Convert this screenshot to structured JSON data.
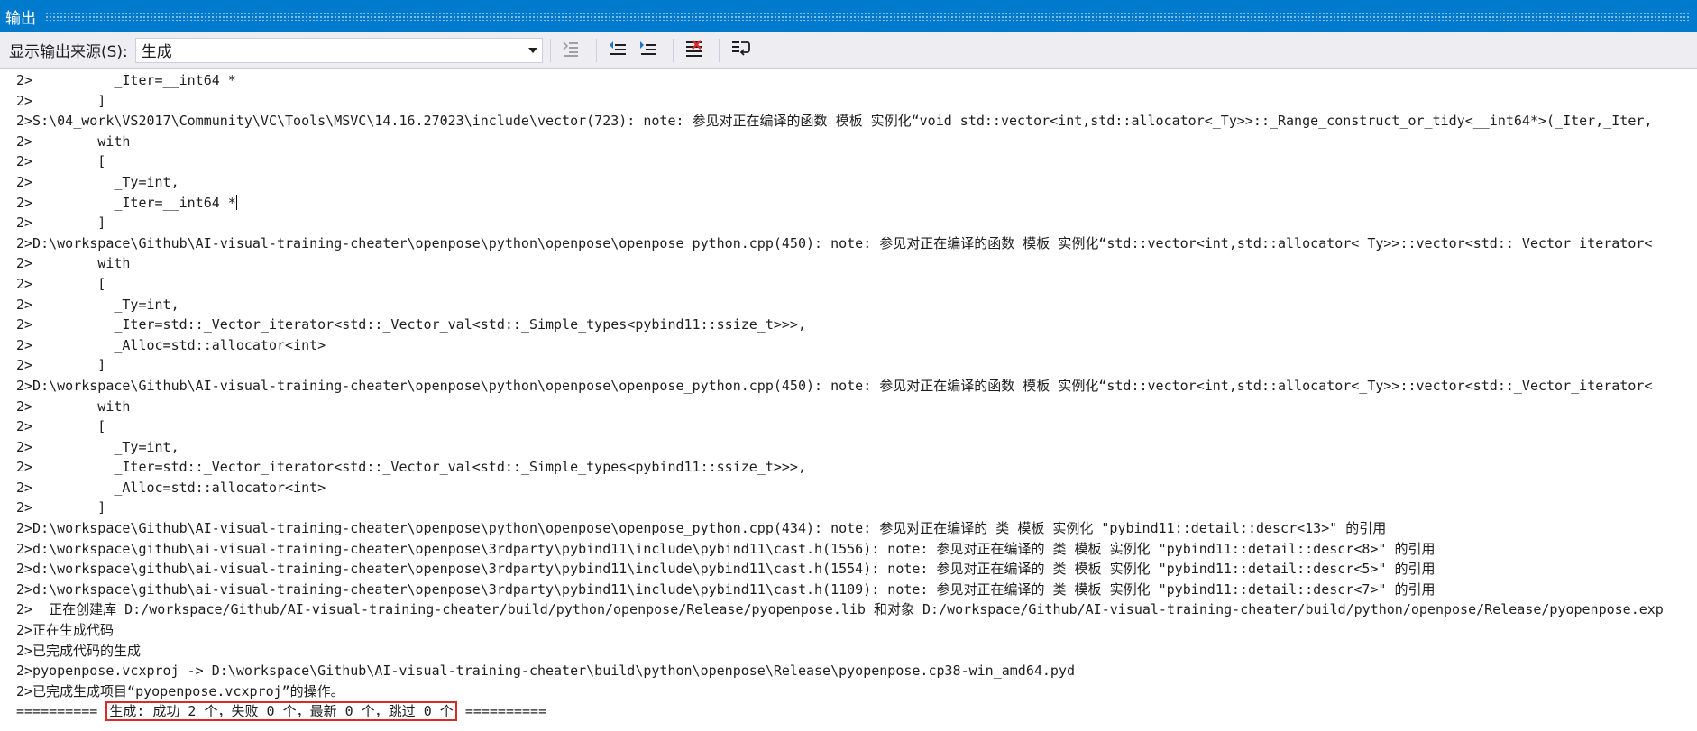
{
  "window": {
    "title": "输出"
  },
  "toolbar": {
    "source_label": "显示输出来源(S):",
    "source_value": "生成",
    "buttons": [
      {
        "icon": "find-message-icon",
        "enabled": false
      },
      {
        "icon": "previous-message-icon",
        "enabled": true
      },
      {
        "icon": "next-message-icon",
        "enabled": true
      },
      {
        "icon": "clear-all-icon",
        "enabled": true
      },
      {
        "icon": "word-wrap-icon",
        "enabled": true
      }
    ]
  },
  "output": {
    "lines": [
      "2>          _Iter=__int64 *",
      "2>        ]",
      "2>S:\\04_work\\VS2017\\Community\\VC\\Tools\\MSVC\\14.16.27023\\include\\vector(723): note: 参见对正在编译的函数 模板 实例化“void std::vector<int,std::allocator<_Ty>>::_Range_construct_or_tidy<__int64*>(_Iter,_Iter,",
      "2>        with",
      "2>        [",
      "2>          _Ty=int,",
      "2>          _Iter=__int64 *",
      "2>        ]",
      "2>D:\\workspace\\Github\\AI-visual-training-cheater\\openpose\\python\\openpose\\openpose_python.cpp(450): note: 参见对正在编译的函数 模板 实例化“std::vector<int,std::allocator<_Ty>>::vector<std::_Vector_iterator<",
      "2>        with",
      "2>        [",
      "2>          _Ty=int,",
      "2>          _Iter=std::_Vector_iterator<std::_Vector_val<std::_Simple_types<pybind11::ssize_t>>>,",
      "2>          _Alloc=std::allocator<int>",
      "2>        ]",
      "2>D:\\workspace\\Github\\AI-visual-training-cheater\\openpose\\python\\openpose\\openpose_python.cpp(450): note: 参见对正在编译的函数 模板 实例化“std::vector<int,std::allocator<_Ty>>::vector<std::_Vector_iterator<",
      "2>        with",
      "2>        [",
      "2>          _Ty=int,",
      "2>          _Iter=std::_Vector_iterator<std::_Vector_val<std::_Simple_types<pybind11::ssize_t>>>,",
      "2>          _Alloc=std::allocator<int>",
      "2>        ]",
      "2>D:\\workspace\\Github\\AI-visual-training-cheater\\openpose\\python\\openpose\\openpose_python.cpp(434): note: 参见对正在编译的 类 模板 实例化 \"pybind11::detail::descr<13>\" 的引用",
      "2>d:\\workspace\\github\\ai-visual-training-cheater\\openpose\\3rdparty\\pybind11\\include\\pybind11\\cast.h(1556): note: 参见对正在编译的 类 模板 实例化 \"pybind11::detail::descr<8>\" 的引用",
      "2>d:\\workspace\\github\\ai-visual-training-cheater\\openpose\\3rdparty\\pybind11\\include\\pybind11\\cast.h(1554): note: 参见对正在编译的 类 模板 实例化 \"pybind11::detail::descr<5>\" 的引用",
      "2>d:\\workspace\\github\\ai-visual-training-cheater\\openpose\\3rdparty\\pybind11\\include\\pybind11\\cast.h(1109): note: 参见对正在编译的 类 模板 实例化 \"pybind11::detail::descr<7>\" 的引用",
      "2>  正在创建库 D:/workspace/Github/AI-visual-training-cheater/build/python/openpose/Release/pyopenpose.lib 和对象 D:/workspace/Github/AI-visual-training-cheater/build/python/openpose/Release/pyopenpose.exp",
      "2>正在生成代码",
      "2>已完成代码的生成",
      "2>pyopenpose.vcxproj -> D:\\workspace\\Github\\AI-visual-training-cheater\\build\\python\\openpose\\Release\\pyopenpose.cp38-win_amd64.pyd",
      "2>已完成生成项目“pyopenpose.vcxproj”的操作。"
    ],
    "summary": {
      "prefix": "==========",
      "text": "生成: 成功 2 个，失败 0 个，最新 0 个，跳过 0 个",
      "suffix": "=========="
    }
  },
  "colors": {
    "title_bar": "#007acc",
    "toolbar": "#eeeef2",
    "highlight": "#d92b2b"
  }
}
